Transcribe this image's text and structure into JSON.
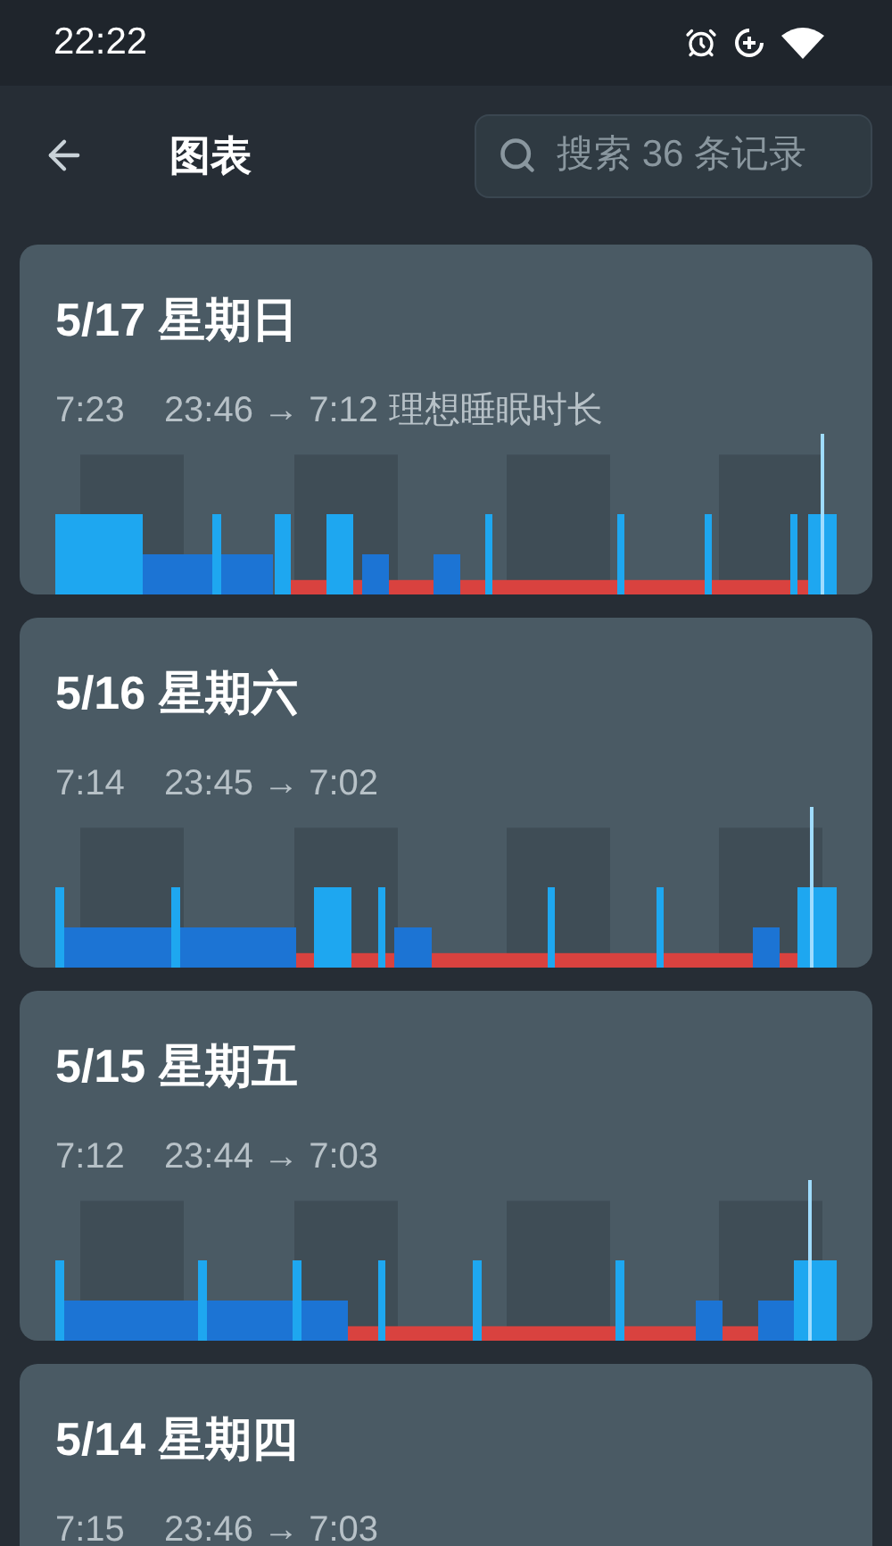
{
  "status_bar": {
    "time": "22:22"
  },
  "header": {
    "title": "图表",
    "search": {
      "placeholder": "搜索 36 条记录"
    }
  },
  "records": [
    {
      "date": "5/17 星期日",
      "duration": "7:23",
      "range": "23:46 → 7:12",
      "note": "理想睡眠时长"
    },
    {
      "date": "5/16 星期六",
      "duration": "7:14",
      "range": "23:45 → 7:02"
    },
    {
      "date": "5/15 星期五",
      "duration": "7:12",
      "range": "23:44 → 7:03"
    },
    {
      "date": "5/14 星期四",
      "duration": "7:15",
      "range": "23:46 → 7:03"
    }
  ]
}
